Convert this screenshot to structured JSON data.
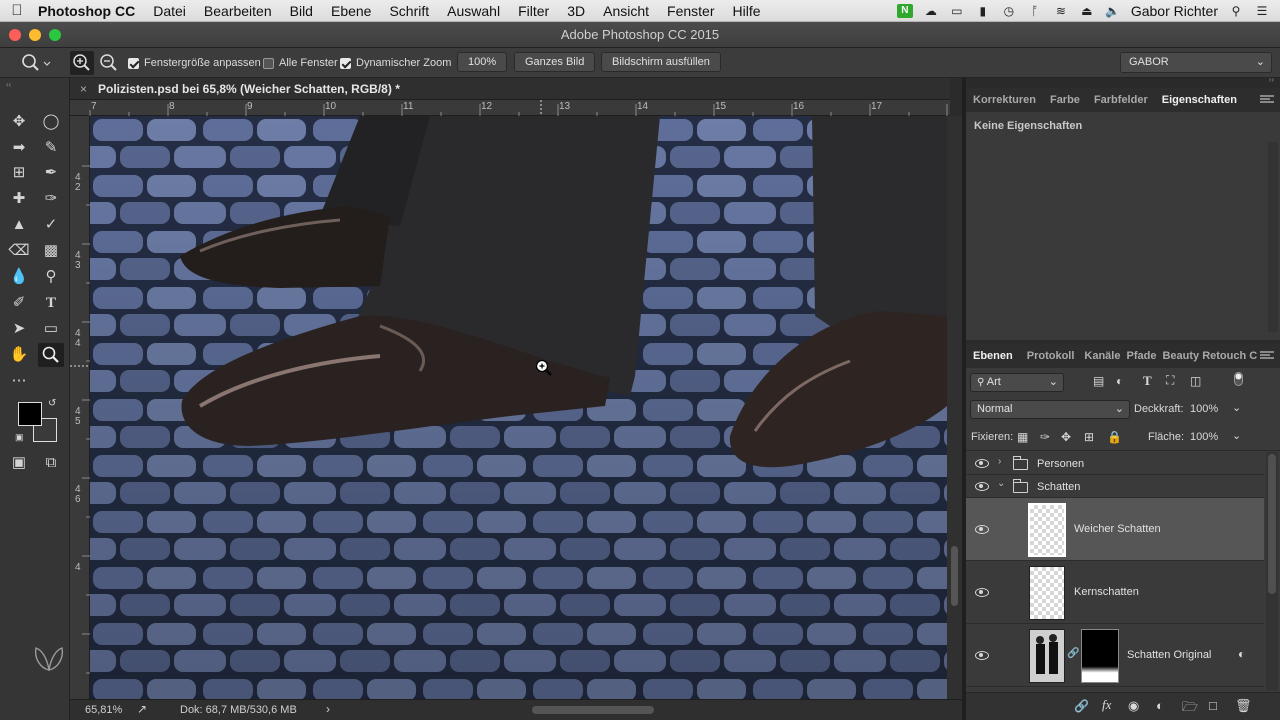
{
  "menubar": {
    "app": "Photoshop CC",
    "items": [
      "Datei",
      "Bearbeiten",
      "Bild",
      "Ebene",
      "Schrift",
      "Auswahl",
      "Filter",
      "3D",
      "Ansicht",
      "Fenster",
      "Hilfe"
    ],
    "user": "Gabor Richter"
  },
  "window": {
    "title": "Adobe Photoshop CC 2015"
  },
  "options": {
    "resize_window": "Fenstergröße anpassen",
    "all_windows": "Alle Fenster",
    "scrubby_zoom": "Dynamischer Zoom",
    "zoom_value": "100%",
    "fit_screen": "Ganzes Bild",
    "fill_screen": "Bildschirm ausfüllen",
    "workspace": "GABOR"
  },
  "document": {
    "tab_title": "Polizisten.psd bei 65,8% (Weicher Schatten, RGB/8) *",
    "ruler_h": [
      "7",
      "8",
      "9",
      "10",
      "11",
      "12",
      "13",
      "14",
      "15",
      "16",
      "17"
    ],
    "ruler_v": [
      "4",
      "2",
      "4",
      "3",
      "4",
      "4",
      "4",
      "5",
      "4",
      "6",
      "4"
    ],
    "zoom": "65,81%",
    "doc_size": "Dok: 68,7 MB/530,6 MB"
  },
  "properties": {
    "tabs": [
      "Korrekturen",
      "Farbe",
      "Farbfelder",
      "Eigenschaften"
    ],
    "active_tab": "Eigenschaften",
    "empty_text": "Keine Eigenschaften"
  },
  "layers": {
    "tabs": [
      "Ebenen",
      "Protokoll",
      "Kanäle",
      "Pfade",
      "Beauty Retouch C"
    ],
    "filter": "Art",
    "blend_mode": "Normal",
    "opacity_label": "Deckkraft:",
    "opacity": "100%",
    "lock_label": "Fixieren:",
    "fill_label": "Fläche:",
    "fill": "100%",
    "items": [
      {
        "name": "Personen"
      },
      {
        "name": "Schatten"
      },
      {
        "name": "Weicher Schatten"
      },
      {
        "name": "Kernschatten"
      },
      {
        "name": "Schatten Original"
      }
    ]
  },
  "colors": {
    "accent_selected_layer": "#565656",
    "canvas_stone": "#6f82b5"
  }
}
